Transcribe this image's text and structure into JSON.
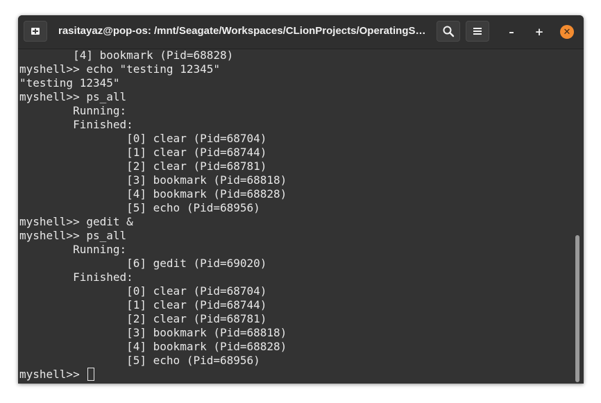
{
  "window": {
    "title": "rasitayaz@pop-os: /mnt/Seagate/Workspaces/CLionProjects/OperatingSy…",
    "new_tab_icon": "new-tab-icon",
    "search_icon": "search-icon",
    "menu_icon": "hamburger-menu-icon",
    "minimize_label": "–",
    "maximize_label": "+",
    "close_label": "✕",
    "close_color": "#f48c30"
  },
  "terminal": {
    "lines": [
      "        [4] bookmark (Pid=68828)",
      "myshell>> echo \"testing 12345\"",
      "\"testing 12345\"",
      "myshell>> ps_all",
      "        Running:",
      "        Finished:",
      "                [0] clear (Pid=68704)",
      "                [1] clear (Pid=68744)",
      "                [2] clear (Pid=68781)",
      "                [3] bookmark (Pid=68818)",
      "                [4] bookmark (Pid=68828)",
      "                [5] echo (Pid=68956)",
      "myshell>> gedit &",
      "myshell>> ps_all",
      "        Running:",
      "                [6] gedit (Pid=69020)",
      "        Finished:",
      "                [0] clear (Pid=68704)",
      "                [1] clear (Pid=68744)",
      "                [2] clear (Pid=68781)",
      "                [3] bookmark (Pid=68818)",
      "                [4] bookmark (Pid=68828)",
      "                [5] echo (Pid=68956)"
    ],
    "prompt": "myshell>> ",
    "scroll_position": 1.0,
    "scroll_visible_fraction": 0.44
  }
}
